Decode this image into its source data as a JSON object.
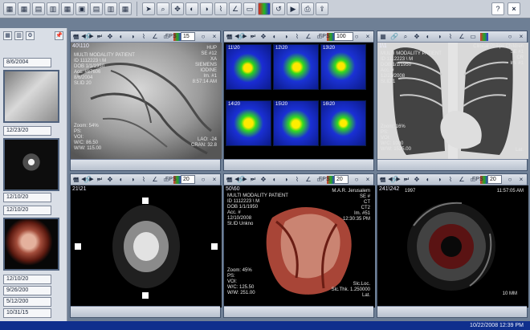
{
  "toolbar": {
    "icons": [
      "grid-icon",
      "grid-2-icon",
      "grid-3-icon",
      "grid-4-icon",
      "layout-icon",
      "layout-2-icon",
      "layout-3-icon",
      "layout-4-icon",
      "layout-5-icon",
      "cursor-icon",
      "zoom-icon",
      "pan-icon",
      "window-level-icon",
      "invert-icon",
      "measure-icon",
      "angle-icon",
      "roi-icon",
      "color-icon",
      "reset-icon",
      "cine-icon",
      "print-icon",
      "export-icon",
      "help-icon",
      "close-icon"
    ]
  },
  "left": {
    "dates": [
      "8/6/2004",
      "12/23/20",
      "12/10/20",
      "12/10/20",
      "12/10/20",
      "9/26/200",
      "5/12/200",
      "10/31/15"
    ]
  },
  "panels": {
    "angio": {
      "index": "40\\110",
      "left": "MULTI MODALITY PATIENT\nID 1112223 \\ M\nDOB 1/1/1950\nAcc. #87606\n8/6/2004\nSt.ID 20",
      "right": "HUP\nSE #12\nXA\nSIEMENS\nIODINE\nIm. #1\n8:57:14 AM",
      "bottom_left": "Zoom: 54%\nPS:\nVOI:\nW/C: 86.50\nW/W: 115.00",
      "bottom_right": "LAO: -24\nCRAN: 32.8",
      "fps": "15"
    },
    "spect": {
      "index": "11\\20",
      "cells": [
        "11\\20",
        "12\\20",
        "13\\20",
        "14\\20",
        "15\\20",
        "16\\20"
      ],
      "fps": "100"
    },
    "xray": {
      "index": "1\\1",
      "left": "MULTI MODALITY PATIENT\nID 1112223 \\ M\nDOB 1/1/1950\nAcc. #\n12/23/2008\nSt.ID 1",
      "right": "Clinical Philips Children\nSE #1\nCR\nIm. #1",
      "bottom_left": "Zoom: 16%\nPS:\nVOI:\nW/C: 1000\nW/W: 1525.00",
      "bottom_right": "Lat.",
      "fps": ""
    },
    "mri": {
      "index": "21\\21",
      "fps": "20"
    },
    "ct": {
      "index": "50\\60",
      "left": "MULTI MODALITY PATIENT\nID 1112223 \\ M\nDOB 1/1/1950\nAcc. #\n12/10/2008\nSt.ID Unkno",
      "right": "M.A.R. Jerusalem\nSE #\nCT\nCT2\nIm. #51\n12:30:35 PM",
      "bottom_left": "Zoom: 45%\nPS:\nVOI:\nW/C: 125.50\nW/W: 251.00",
      "bottom_right": "Slc.Loc.\nSlc.Thk. 1.250000\nLat.",
      "fps": "20"
    },
    "ivus": {
      "index": "241\\242",
      "date": "1997",
      "time": "11:57:05 AM",
      "scale": "10 MM",
      "fps": "20"
    }
  },
  "status": {
    "datetime": "10/22/2008  12:39 PM"
  }
}
